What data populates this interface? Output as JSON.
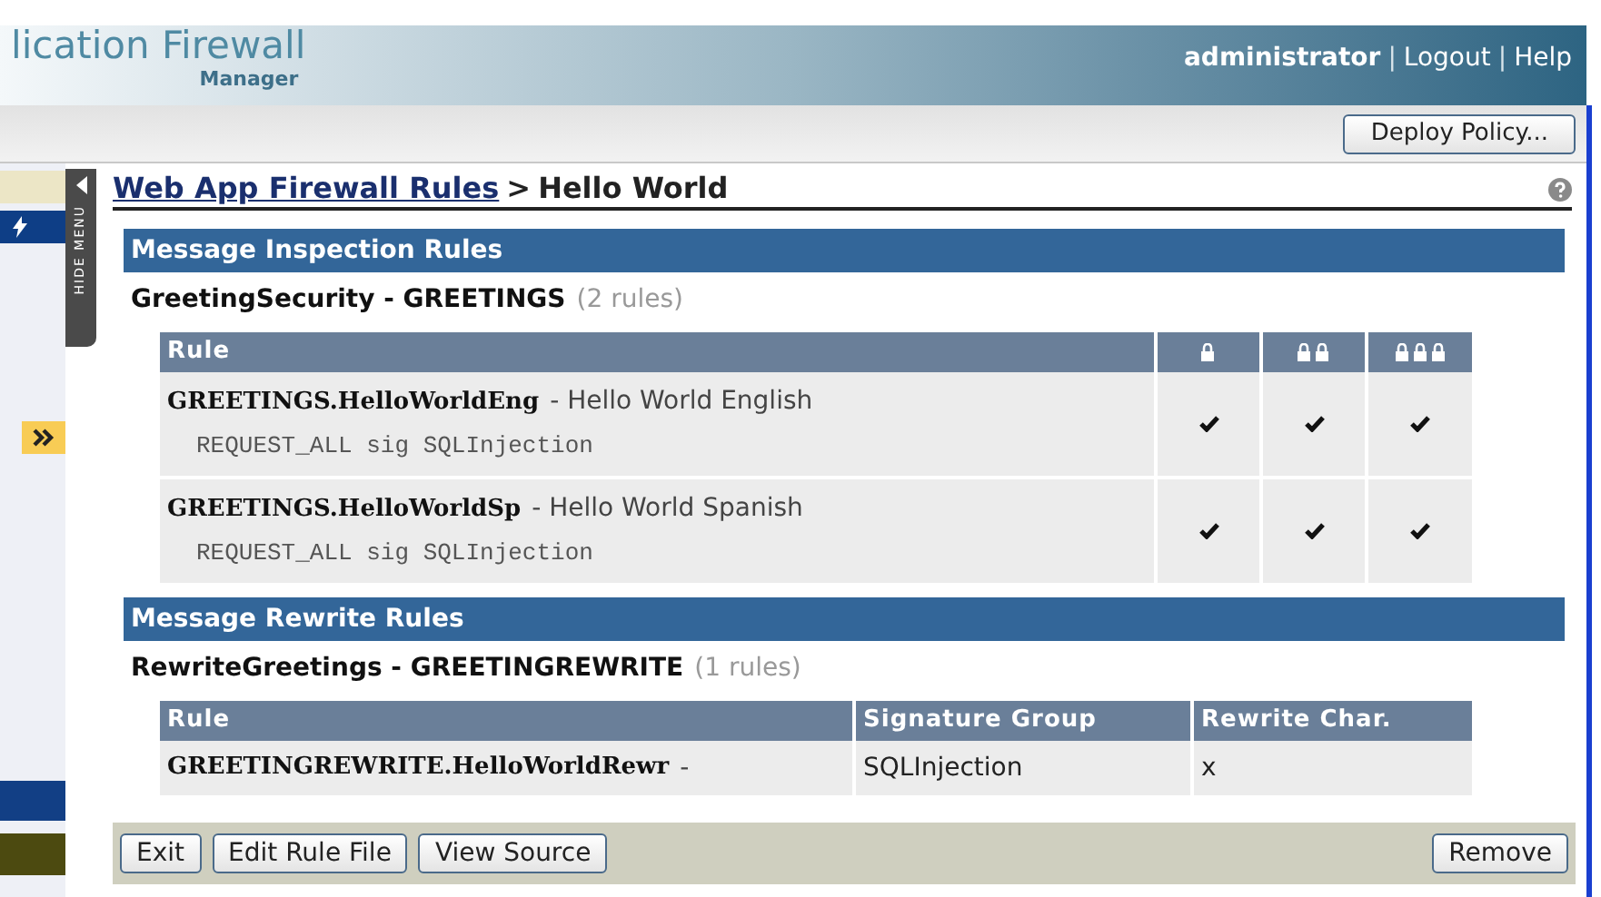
{
  "header": {
    "title": "lication Firewall",
    "subtitle": "Manager",
    "user": "administrator",
    "links": [
      {
        "separator": "|",
        "label": "Logout"
      },
      {
        "separator": "|",
        "label": "Help"
      }
    ]
  },
  "toolbar": {
    "button": "Deploy Policy..."
  },
  "side_menu": {
    "toggle": "HIDE MENU"
  },
  "breadcrumb": {
    "link": "Web App Firewall Rules",
    "separator": ">",
    "current": "Hello World"
  },
  "inspection": {
    "title": "Message Inspection Rules",
    "group": "GreetingSecurity - GREETINGS",
    "count": "(2 rules)",
    "columns": [
      "Rule"
    ],
    "rows": [
      {
        "name": "GREETINGS.HelloWorldEng",
        "description": "- Hello World English",
        "detail": "REQUEST_ALL sig SQLInjection",
        "levels": [
          {
            "checked": true
          },
          {
            "checked": true
          },
          {
            "checked": true
          }
        ]
      },
      {
        "name": "GREETINGS.HelloWorldSp",
        "description": "- Hello World Spanish",
        "detail": "REQUEST_ALL sig SQLInjection",
        "levels": [
          {
            "checked": true
          },
          {
            "checked": true
          },
          {
            "checked": true
          }
        ]
      }
    ]
  },
  "rewrite": {
    "title": "Message Rewrite Rules",
    "group": "RewriteGreetings - GREETINGREWRITE",
    "count": "(1 rules)",
    "columns": [
      "Rule",
      "Signature Group",
      "Rewrite Char."
    ],
    "rows": [
      {
        "name": "GREETINGREWRITE.HelloWorldRewr",
        "description": "-",
        "signature_group": "SQLInjection",
        "rewrite_char": "x"
      }
    ]
  },
  "footer": {
    "left_buttons": [
      "Exit",
      "Edit Rule File",
      "View Source"
    ],
    "right_buttons": [
      "Remove"
    ]
  }
}
